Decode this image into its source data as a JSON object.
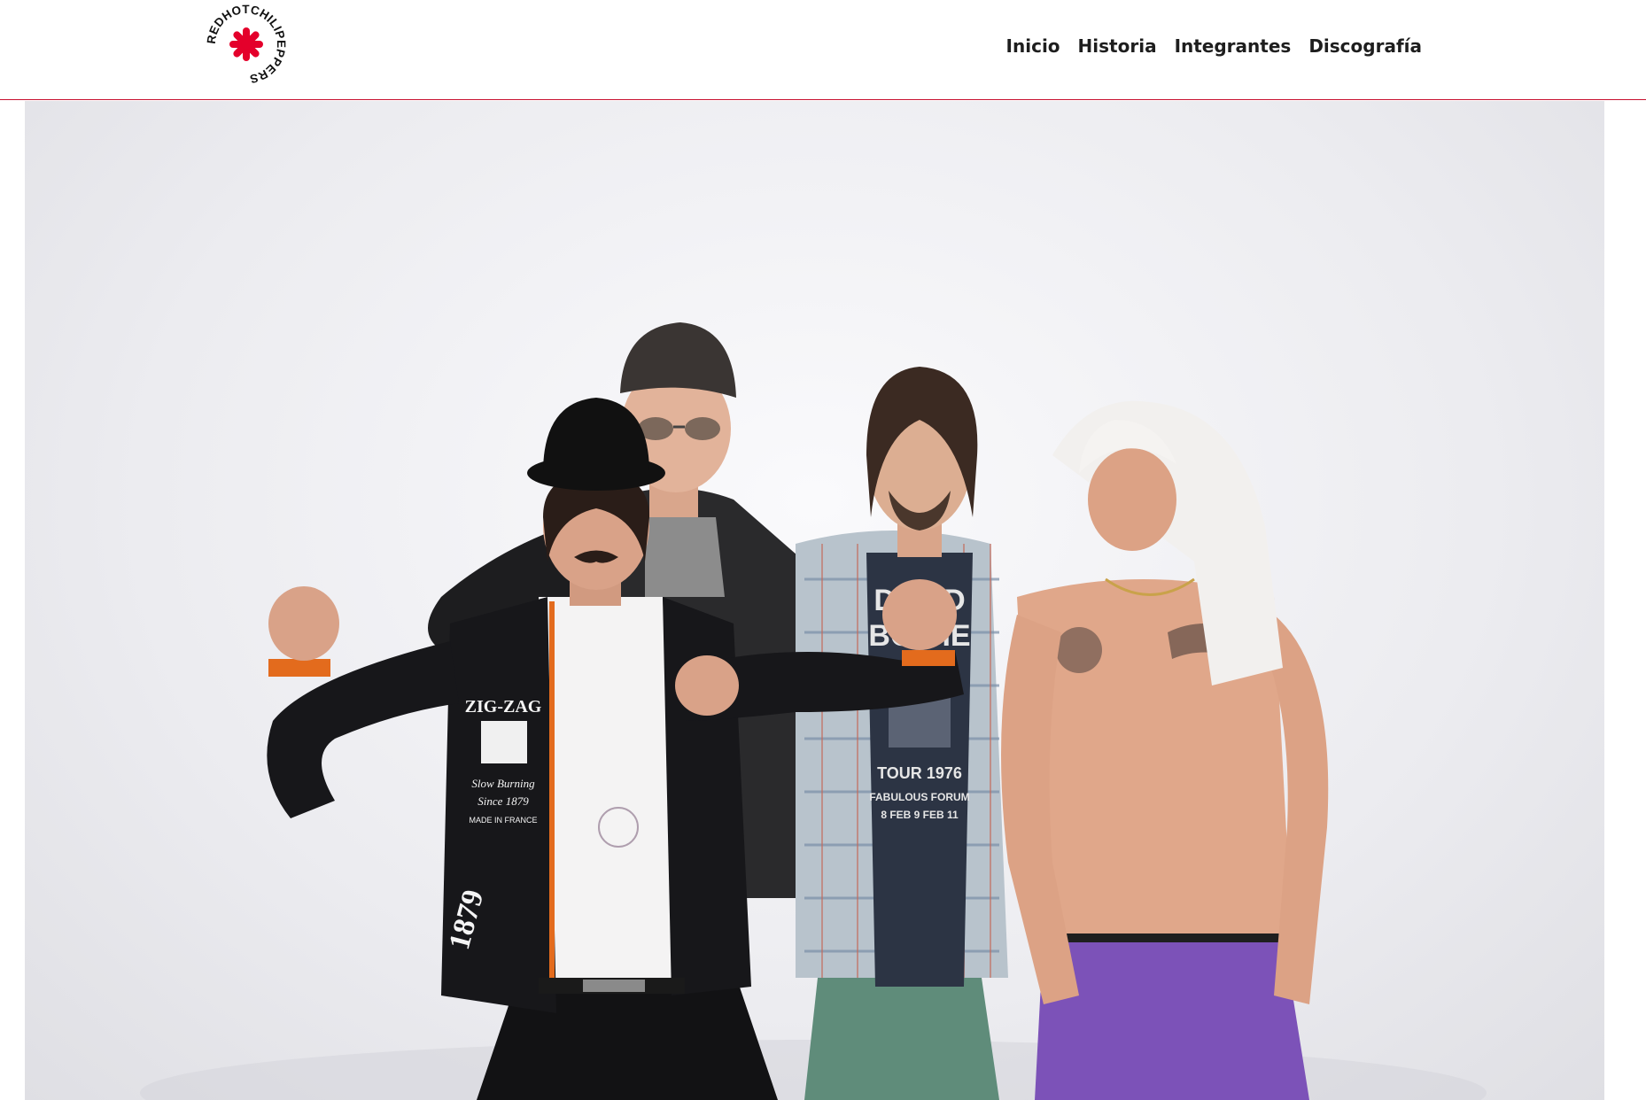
{
  "header": {
    "logo": {
      "text": "REDHOTCHILIPEPPERS",
      "icon": "asterisk-logo-icon",
      "accent_color": "#e4002b"
    },
    "nav": [
      {
        "label": "Inicio"
      },
      {
        "label": "Historia"
      },
      {
        "label": "Integrantes"
      },
      {
        "label": "Discografía"
      }
    ],
    "divider_color": "#c8102e"
  },
  "hero": {
    "icon": "band-photo-image",
    "shirt_text": {
      "center_brand": "ZIG-ZAG",
      "center_line1": "Slow Burning",
      "center_line2": "Since 1879",
      "center_line3": "MADE IN FRANCE",
      "sleeve_number": "1879",
      "tee_line1": "DAVID",
      "tee_line2": "BOWIE",
      "tee_line3": "TOUR 1976",
      "tee_line4": "FABULOUS FORUM",
      "tee_line5": "8 FEB 9 FEB 11"
    }
  }
}
